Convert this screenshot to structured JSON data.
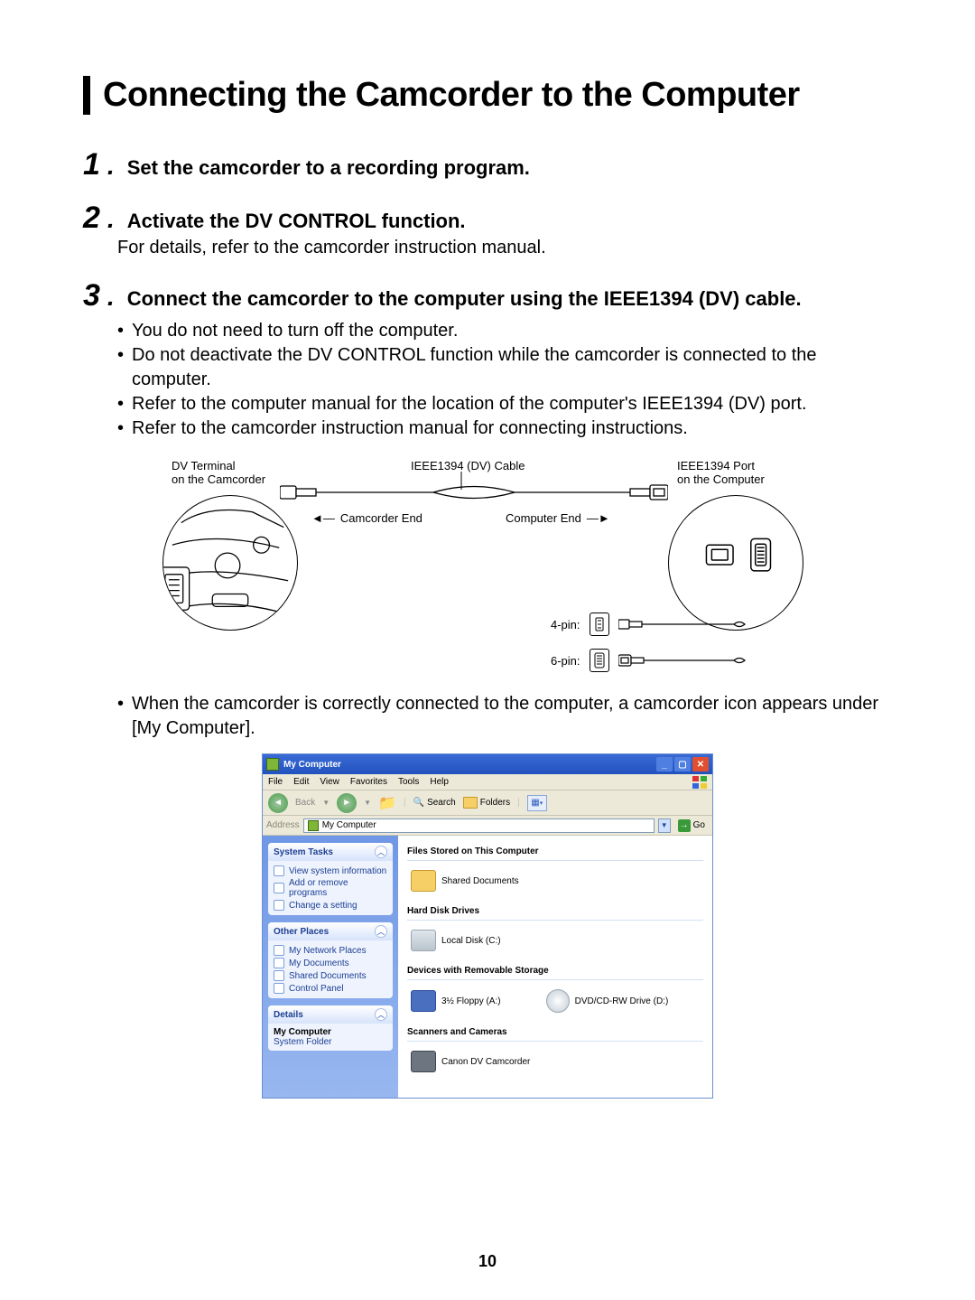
{
  "title": "Connecting the Camcorder to the Computer",
  "page_number": "10",
  "steps": [
    {
      "num": "1",
      "title": "Set the camcorder to a recording program.",
      "body": [],
      "bullets": []
    },
    {
      "num": "2",
      "title": "Activate the DV CONTROL function.",
      "body": [
        "For details, refer to the camcorder instruction manual."
      ],
      "bullets": []
    },
    {
      "num": "3",
      "title": "Connect the camcorder to the computer using the IEEE1394 (DV) cable.",
      "body": [],
      "bullets": [
        "You do not need to turn off the computer.",
        "Do not deactivate the DV CONTROL function while the camcorder is connected to the computer.",
        "Refer to the computer manual for the location of the computer's IEEE1394 (DV) port.",
        "Refer to the camcorder instruction manual for connecting instructions."
      ]
    }
  ],
  "diagram": {
    "dv_terminal_l1": "DV Terminal",
    "dv_terminal_l2": "on the Camcorder",
    "cable_label": "IEEE1394 (DV) Cable",
    "port_l1": "IEEE1394 Port",
    "port_l2": "on the Computer",
    "camcorder_end": "Camcorder End",
    "computer_end": "Computer End",
    "pin4": "4-pin:",
    "pin6": "6-pin:"
  },
  "after_diagram_bullet": "When the camcorder is correctly connected to the computer, a camcorder icon appears under [My Computer].",
  "window": {
    "title": "My Computer",
    "menu": [
      "File",
      "Edit",
      "View",
      "Favorites",
      "Tools",
      "Help"
    ],
    "toolbar": {
      "back": "Back",
      "search": "Search",
      "folders": "Folders"
    },
    "address_label": "Address",
    "address_value": "My Computer",
    "go": "Go",
    "side": {
      "system_tasks": {
        "header": "System Tasks",
        "links": [
          "View system information",
          "Add or remove programs",
          "Change a setting"
        ]
      },
      "other_places": {
        "header": "Other Places",
        "links": [
          "My Network Places",
          "My Documents",
          "Shared Documents",
          "Control Panel"
        ]
      },
      "details": {
        "header": "Details",
        "title": "My Computer",
        "sub": "System Folder"
      }
    },
    "main": {
      "sect1": "Files Stored on This Computer",
      "item1": "Shared Documents",
      "sect2": "Hard Disk Drives",
      "item2": "Local Disk (C:)",
      "sect3": "Devices with Removable Storage",
      "item3a": "3½ Floppy (A:)",
      "item3b": "DVD/CD-RW Drive (D:)",
      "sect4": "Scanners and Cameras",
      "item4": "Canon DV Camcorder"
    }
  }
}
